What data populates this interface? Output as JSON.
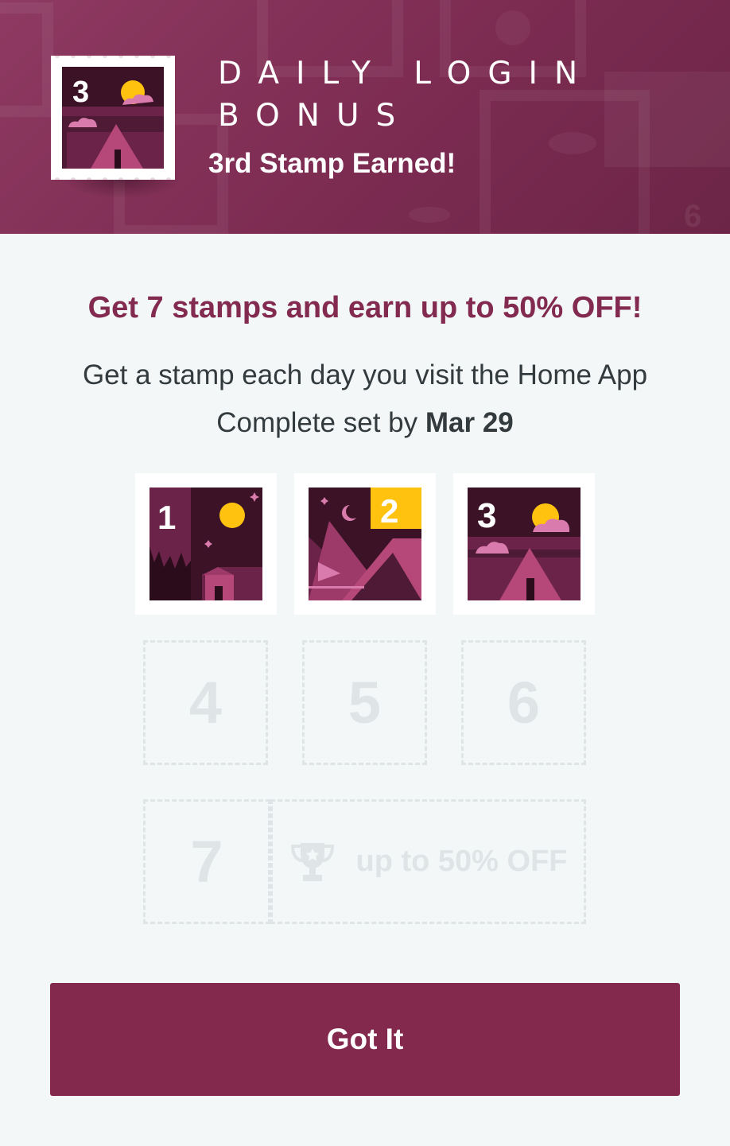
{
  "header": {
    "title_line1": "DAILY LOGIN",
    "title_line2": "BONUS",
    "subtitle": "3rd Stamp Earned!",
    "stamp_number": "3"
  },
  "offer": {
    "headline": "Get 7 stamps and earn up to 50% OFF!",
    "line1": "Get a stamp each day you visit the Home App",
    "line2_prefix": "Complete set by ",
    "deadline": "Mar 29"
  },
  "stamps": {
    "earned": [
      "1",
      "2",
      "3"
    ],
    "remaining": [
      "4",
      "5",
      "6",
      "7"
    ],
    "reward_label": "up to 50% OFF",
    "reward_icon": "trophy-icon"
  },
  "actions": {
    "got_it": "Got It"
  },
  "colors": {
    "brand": "#84294e",
    "headline": "#822a4f",
    "stamp_dark": "#3c1326",
    "stamp_mid": "#6b2349",
    "stamp_pink": "#b54878",
    "sun": "#ffc20e",
    "placeholder": "#dfe5e6"
  }
}
